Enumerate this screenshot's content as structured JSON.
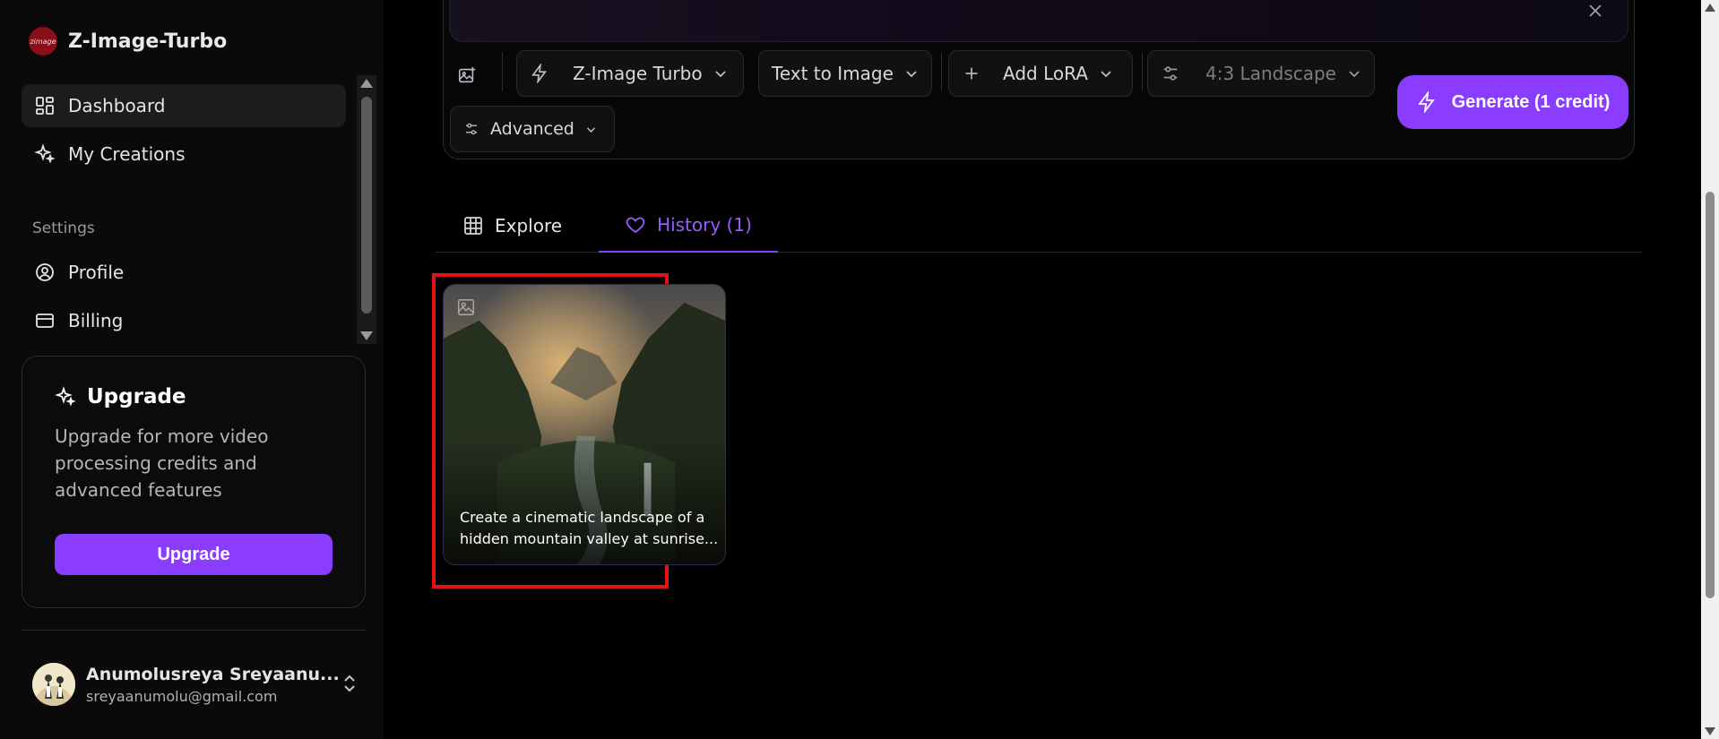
{
  "app": {
    "title": "Z-Image-Turbo",
    "logo_text": "zimage"
  },
  "sidebar": {
    "items": [
      {
        "label": "Dashboard",
        "icon": "dashboard-icon"
      },
      {
        "label": "My Creations",
        "icon": "sparkle-icon"
      }
    ],
    "settings_label": "Settings",
    "settings_items": [
      {
        "label": "Profile",
        "icon": "user-circle-icon"
      },
      {
        "label": "Billing",
        "icon": "credit-card-icon"
      }
    ],
    "upgrade": {
      "title": "Upgrade",
      "description": "Upgrade for more video processing credits and advanced features",
      "button": "Upgrade"
    },
    "user": {
      "name": "Anumolusreya Sreyaanu...",
      "email": "sreyaanumolu@gmail.com"
    }
  },
  "toolbar": {
    "model": "Z-Image Turbo",
    "mode": "Text to Image",
    "lora": "Add LoRA",
    "aspect": "4:3 Landscape",
    "advanced": "Advanced",
    "generate": "Generate (1 credit)"
  },
  "tabs": {
    "explore": "Explore",
    "history": "History (1)"
  },
  "history": [
    {
      "caption": "Create a cinematic landscape of a hidden mountain valley at sunrise..."
    }
  ],
  "colors": {
    "accent": "#8b3dff",
    "highlight": "#e01414"
  }
}
